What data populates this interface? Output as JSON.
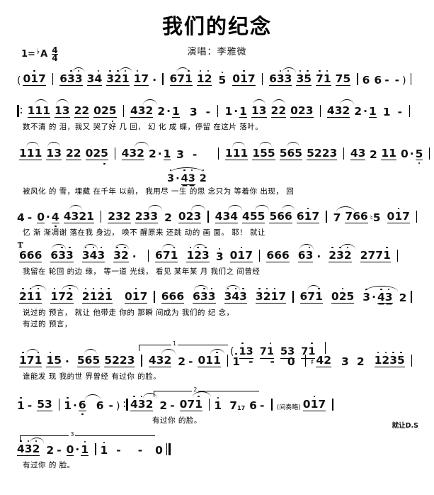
{
  "header": {
    "title": "我们的纪念",
    "subtitle": "演唱：李雅微",
    "key_label": "1=",
    "key_accidental": "♭",
    "key_note": "A",
    "time_num": "4",
    "time_den": "4"
  },
  "symbols": {
    "segno": "𝄋",
    "repeat_open": "‖:",
    "repeat_close": ":‖",
    "end_barline": "‖",
    "sharp": "♯",
    "natural": "♮",
    "open_paren": "(",
    "close_paren": ")"
  },
  "score": {
    "lines": [
      {
        "id": "intro",
        "notes": "( 017 | 633 34 321 17· | 671 12 5 017 | 633 35 71 75 | 6 6 - - ) |",
        "lyrics": ""
      },
      {
        "id": "verse1a",
        "notes": "|: 111 13 22 025 | 432 2·1 3 - | 1·1 13 22 023 | 432 2·1 1 - |",
        "lyrics": "数不清 的 泪，我又 哭了好 几 回， 幻 化 成 蝶，停留 在这片 落叶。"
      },
      {
        "id": "verse1b",
        "notes": "111 13 22 025 | 432 2·1 3 - | 111 155 565 5223 | 43 2 11 0·5 |",
        "alt_notes": "3·43 2",
        "lyrics": "被风化 的 雪，埋藏 在千年 以前， 我用尽 一生 的思 念只为 等着你 出现， 回"
      },
      {
        "id": "verse1c",
        "notes": "4 - 0·4 4321 | 232 233 2 023 | 434 455 566 617 | 7 766 ♮5 017 |",
        "lyrics": "忆 渐 渐凋谢 落在我 身边， 唤不 醒原来 还跳 动的 画 面。 耶！ 就让"
      },
      {
        "id": "chorus1",
        "notes": "666 633 343 32· | 671 123 3 017 | 666 63· 232 2771 |",
        "lyrics": "我留在 轮回 的边 缘， 等一道 光线， 看见 某年某 月 我们之 间曾经",
        "segno": true
      },
      {
        "id": "chorus2",
        "notes": "211 172 2121 017 | 666 633 343 3217 | 671 025 3·43 2 |",
        "lyrics": "说过的 预言， 就让 他带走 你的 那瞬 间成为 我们的 纪 念，",
        "lyrics2": "有过的 预言，"
      },
      {
        "id": "chorus3",
        "notes": "171 15· 565 5223 | 432 2 - 011 | 1 - - 0 | ♯42 3 2 1235 |",
        "lyrics": "谁能发 现 我的世 界曾经 有过你 的脸。",
        "volta": "1",
        "volta_pickup": "( 13 71 53 71 |"
      },
      {
        "id": "tail1",
        "notes": "1 - 53 | 1 · 6 6 - ) :‖ 432 2 - 071 | 1 7♮ 6 - | (间奏略) 017 |",
        "lyrics": "有过你 的脸。",
        "volta": "2",
        "tag": "(间奏略)",
        "ds": "就让D.S"
      },
      {
        "id": "tail2",
        "notes": "432 2 - 0·1 | 1 - - 0 ‖",
        "lyrics": "有过你 的 脸。",
        "volta": "3"
      }
    ]
  }
}
